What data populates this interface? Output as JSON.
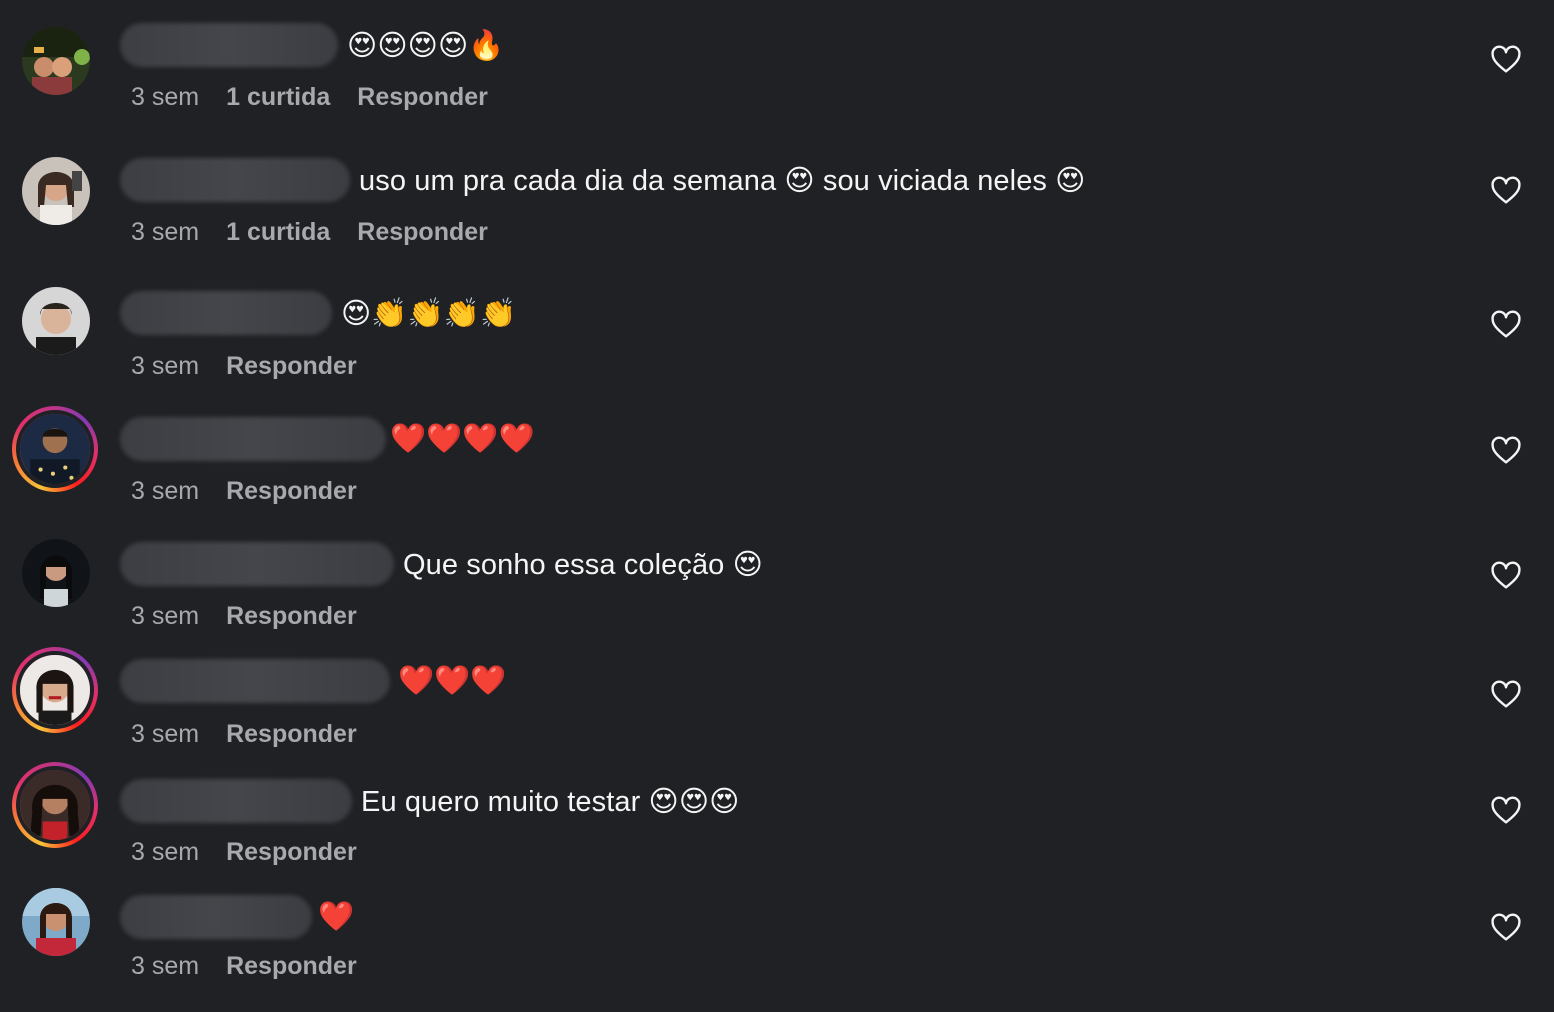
{
  "comments": [
    {
      "text": "😍😍😍😍🔥",
      "time": "3 sem",
      "likes": "1 curtida",
      "reply": "Responder"
    },
    {
      "text": "uso um pra cada dia da semana 😍 sou viciada neles 😍",
      "time": "3 sem",
      "likes": "1 curtida",
      "reply": "Responder"
    },
    {
      "text": "😍👏👏👏👏",
      "time": "3 sem",
      "reply": "Responder"
    },
    {
      "text": "❤️❤️❤️❤️",
      "time": "3 sem",
      "reply": "Responder"
    },
    {
      "text": "Que sonho essa coleção 😍",
      "time": "3 sem",
      "reply": "Responder"
    },
    {
      "text": "❤️❤️❤️",
      "time": "3 sem",
      "reply": "Responder"
    },
    {
      "text": "Eu quero muito testar 😍😍😍",
      "time": "3 sem",
      "reply": "Responder"
    },
    {
      "text": "❤️",
      "time": "3 sem",
      "reply": "Responder"
    }
  ],
  "icons": {
    "like": "heart-outline-icon"
  },
  "colors": {
    "background": "#202125",
    "text": "#f5f5f5",
    "meta": "#a8a9ad",
    "story_ring": "#e1306c"
  }
}
